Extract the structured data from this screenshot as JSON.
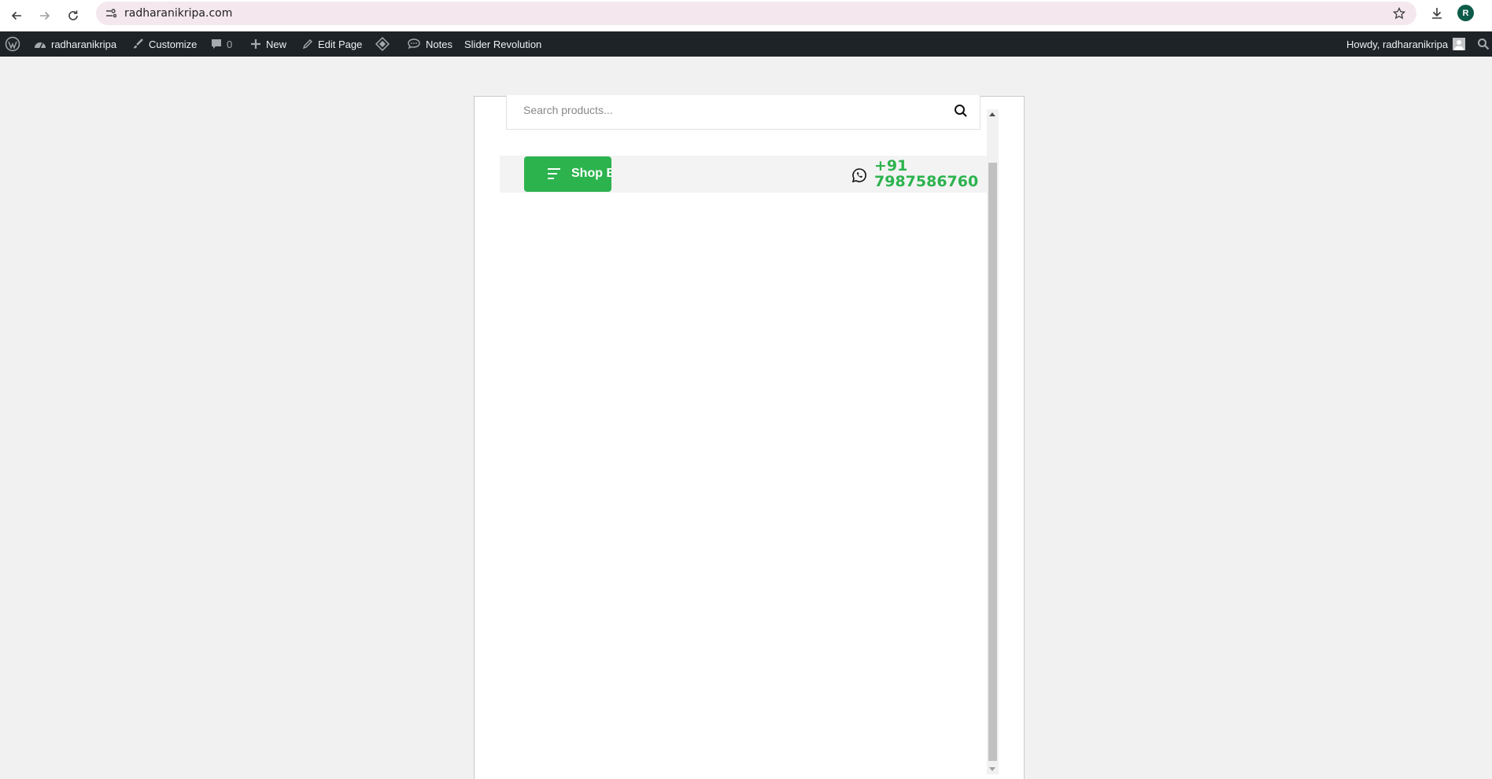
{
  "browser": {
    "url": "radharanikripa.com",
    "profile_initial": "R",
    "icons": [
      "back-icon",
      "forward-icon",
      "reload-icon",
      "site-settings-icon",
      "bookmark-star-icon",
      "download-icon"
    ]
  },
  "adminbar": {
    "site_name": "radharanikripa",
    "customize": "Customize",
    "comments_count": "0",
    "new": "New",
    "edit_page": "Edit Page",
    "notes": "Notes",
    "slider_revolution": "Slider Revolution",
    "howdy": "Howdy, radharanikripa"
  },
  "preview": {
    "search_placeholder": "Search products...",
    "shop_button_label": "Shop B",
    "phone_line1": "+91",
    "phone_line2": "7987586760"
  },
  "colors": {
    "accent_green": "#2cb34e",
    "adminbar_bg": "#1d2327",
    "omnibox_bg": "#f4e8ee",
    "page_bg": "#f1f1f1"
  }
}
